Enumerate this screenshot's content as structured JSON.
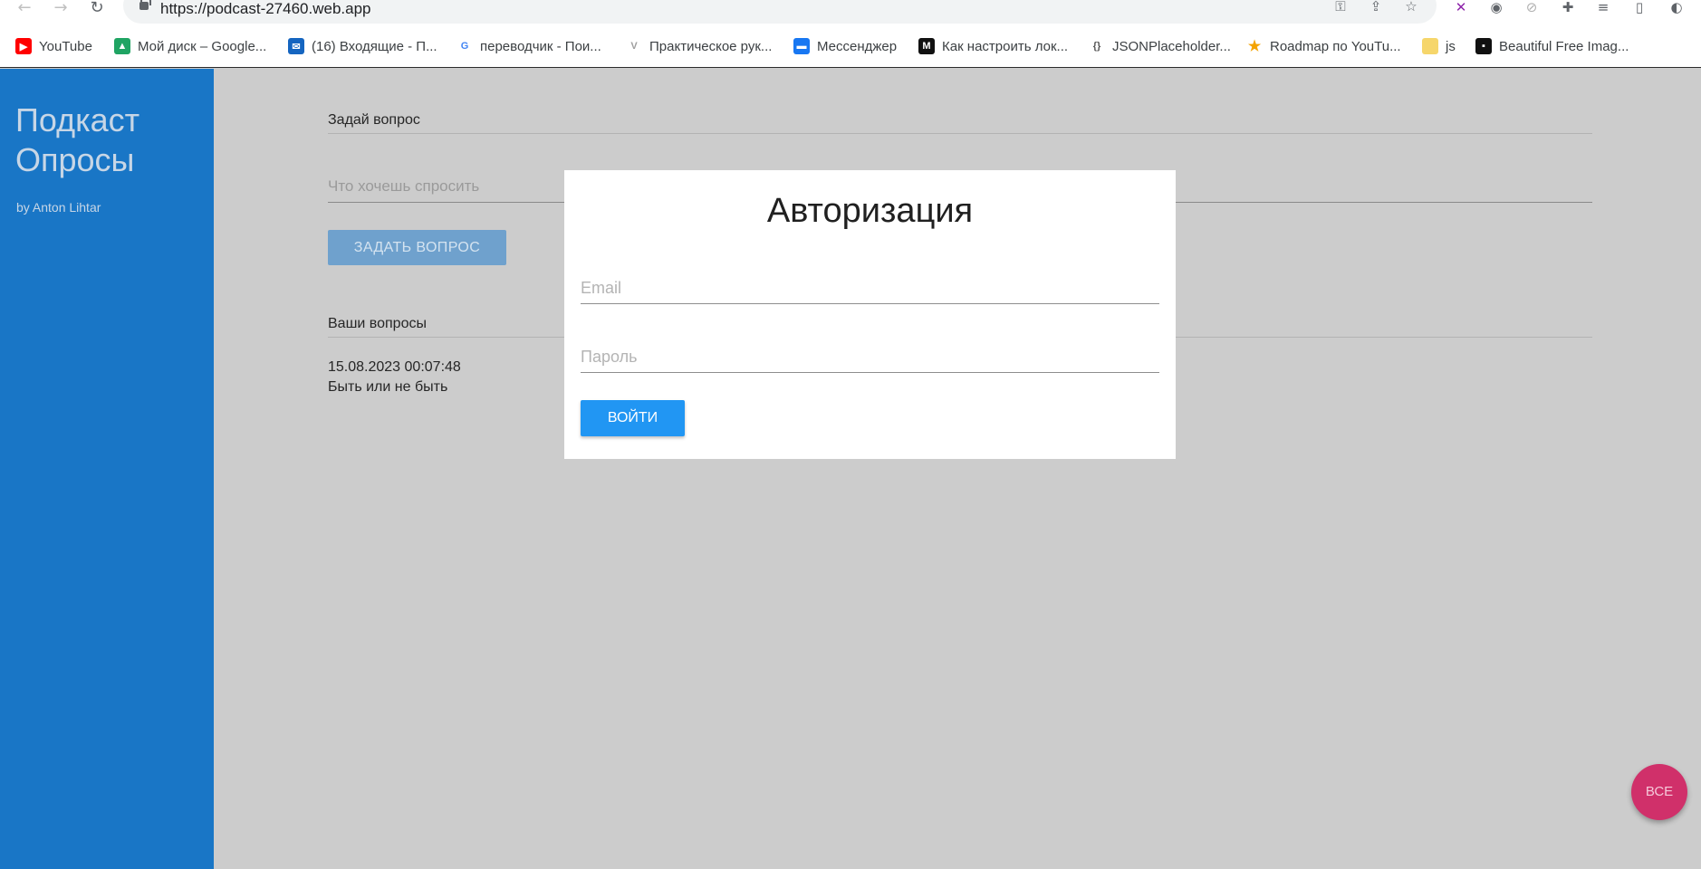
{
  "browser": {
    "url": "https://podcast-27460.web.app",
    "nav_icons": {
      "back": "back-arrow-icon",
      "forward": "forward-arrow-icon",
      "reload": "reload-icon"
    },
    "bookmarks": [
      {
        "label": "YouTube",
        "icon": "youtube-icon",
        "color": "#ff0000"
      },
      {
        "label": "Мой диск – Google...",
        "icon": "google-drive-icon",
        "color": "#1fa463"
      },
      {
        "label": "(16) Входящие - П...",
        "icon": "mail-icon",
        "color": "#1565c0"
      },
      {
        "label": "переводчик - Пои...",
        "icon": "google-icon",
        "color": "#4285f4"
      },
      {
        "label": "Практическое рук...",
        "icon": "doc-icon",
        "color": "#9e9e9e"
      },
      {
        "label": "Мессенджер",
        "icon": "messenger-icon",
        "color": "#1877f2"
      },
      {
        "label": "Как настроить лок...",
        "icon": "m-icon",
        "color": "#111111"
      },
      {
        "label": "JSONPlaceholder...",
        "icon": "json-icon",
        "color": "#555555"
      },
      {
        "label": "Roadmap по YouTu...",
        "icon": "star-icon",
        "color": "#f4a300"
      },
      {
        "label": "js",
        "icon": "folder-icon",
        "color": "#f6d66b"
      },
      {
        "label": "Beautiful Free Imag...",
        "icon": "unsplash-icon",
        "color": "#111111"
      }
    ]
  },
  "sidebar": {
    "title": "Подкаст Опросы",
    "author": "by Anton Lihtar"
  },
  "main": {
    "ask_label": "Задай вопрос",
    "question_placeholder": "Что хочешь спросить",
    "ask_button": "ЗАДАТЬ ВОПРОС",
    "your_questions_label": "Ваши вопросы",
    "questions": [
      {
        "date": "15.08.2023 00:07:48",
        "text": "Быть или не быть"
      }
    ]
  },
  "modal": {
    "title": "Авторизация",
    "email_placeholder": "Email",
    "password_placeholder": "Пароль",
    "login_button": "ВОЙТИ"
  },
  "fab": {
    "label": "ВСЕ",
    "color": "#d0306a"
  },
  "colors": {
    "sidebar": "#1976c6",
    "overlay": "#cccccc",
    "primary": "#2196f3"
  }
}
